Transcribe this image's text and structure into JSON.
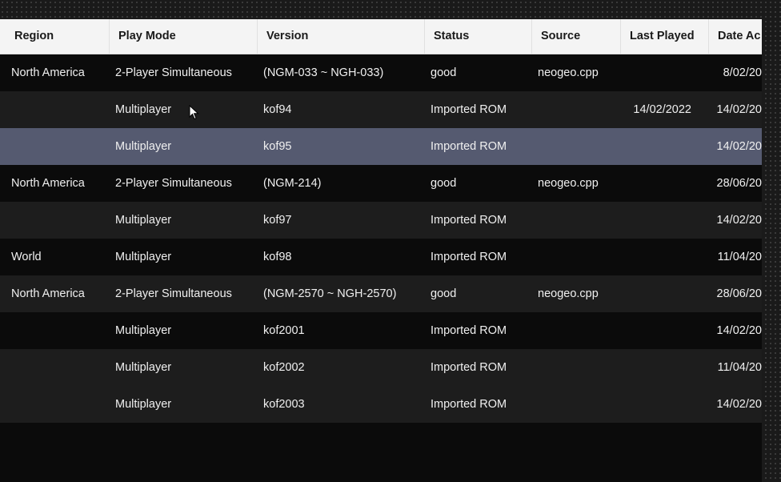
{
  "columns": {
    "region": "Region",
    "play_mode": "Play Mode",
    "version": "Version",
    "status": "Status",
    "source": "Source",
    "last_played": "Last Played",
    "date_added": "Date Ac"
  },
  "rows": [
    {
      "region": "North America",
      "play_mode": "2-Player Simultaneous",
      "version": "(NGM-033 ~ NGH-033)",
      "status": "good",
      "source": "neogeo.cpp",
      "last_played": "",
      "date_added": "8/02/20"
    },
    {
      "region": "",
      "play_mode": "Multiplayer",
      "version": "kof94",
      "status": "Imported ROM",
      "source": "",
      "last_played": "14/02/2022",
      "date_added": "14/02/20"
    },
    {
      "region": "",
      "play_mode": "Multiplayer",
      "version": "kof95",
      "status": "Imported ROM",
      "source": "",
      "last_played": "",
      "date_added": "14/02/20"
    },
    {
      "region": "North America",
      "play_mode": "2-Player Simultaneous",
      "version": "(NGM-214)",
      "status": "good",
      "source": "neogeo.cpp",
      "last_played": "",
      "date_added": "28/06/20"
    },
    {
      "region": "",
      "play_mode": "Multiplayer",
      "version": "kof97",
      "status": "Imported ROM",
      "source": "",
      "last_played": "",
      "date_added": "14/02/20"
    },
    {
      "region": "World",
      "play_mode": "Multiplayer",
      "version": "kof98",
      "status": "Imported ROM",
      "source": "",
      "last_played": "",
      "date_added": "11/04/20"
    },
    {
      "region": "North America",
      "play_mode": "2-Player Simultaneous",
      "version": "(NGM-2570 ~ NGH-2570)",
      "status": "good",
      "source": "neogeo.cpp",
      "last_played": "",
      "date_added": "28/06/20"
    },
    {
      "region": "",
      "play_mode": "Multiplayer",
      "version": "kof2001",
      "status": "Imported ROM",
      "source": "",
      "last_played": "",
      "date_added": "14/02/20"
    },
    {
      "region": "",
      "play_mode": "Multiplayer",
      "version": "kof2002",
      "status": "Imported ROM",
      "source": "",
      "last_played": "",
      "date_added": "11/04/20"
    },
    {
      "region": "",
      "play_mode": "Multiplayer",
      "version": "kof2003",
      "status": "Imported ROM",
      "source": "",
      "last_played": "",
      "date_added": "14/02/20"
    }
  ],
  "selected_row_index": 2,
  "colors": {
    "header_bg": "#f4f4f4",
    "row_dark": "#0b0b0b",
    "row_light": "#1d1d1d",
    "row_selected": "#555a70",
    "text": "#f0f0f0"
  },
  "icons": {
    "cursor": "mouse-pointer-icon"
  }
}
